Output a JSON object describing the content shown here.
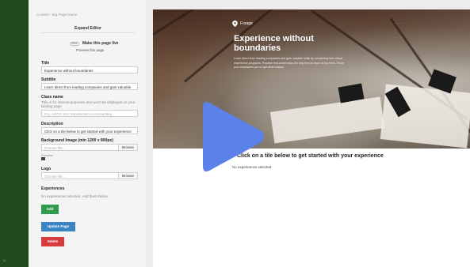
{
  "editor": {
    "breadcrumb": "Content › Big Page Name",
    "expand_label": "Expand Editor",
    "toggle_text": "false",
    "live_label": "Make this page live",
    "preview_link": "Preview this page",
    "title": {
      "label": "Title",
      "value": "Experience without boundaries"
    },
    "subtitle": {
      "label": "Subtitle",
      "value": "Learn direct from leading companies and gain valuable"
    },
    "class_name": {
      "label": "Class name",
      "help": "This is for internal purposes and won't be displayed on your landing page",
      "placeholder": "E.g. ACCG 101: Introduction to Accounting"
    },
    "description": {
      "label": "Description",
      "value": "Click on a tile below to get started with your experience"
    },
    "background_image": {
      "label": "Background Image (min 1200 x 800px)",
      "placeholder": "Choose file...",
      "browse": "Browse",
      "preview_label": "Preview:"
    },
    "logo": {
      "label": "Logo",
      "placeholder": "Choose file...",
      "browse": "Browse"
    },
    "experiences": {
      "label": "Experiences",
      "empty": "No experiences selected. Add them below."
    },
    "add_label": "Add",
    "update_label": "Update Page",
    "delete_label": "Delete"
  },
  "preview": {
    "logo_text": "Forage",
    "top_links": "···  ·  · ·",
    "hero_title": "Experience without boundaries",
    "hero_text": "Learn direct from leading companies and gain valuable skills by completing free virtual experience programs. Practise real-world tasks the way they're done at top firms. Show your employers you've got what it takes.",
    "tile_heading": "Click on a tile below to get started with your experience",
    "no_experiences": "No experiences selected"
  },
  "sidebar": {
    "footer": "<"
  },
  "colors": {
    "sidebar": "#1f4a1e",
    "add": "#2e9b4f",
    "update": "#3b84c4",
    "delete": "#d63c3c",
    "play": "#5b82e8"
  },
  "icons": {
    "play": "play-triangle-icon",
    "logo": "forage-logo-icon"
  }
}
